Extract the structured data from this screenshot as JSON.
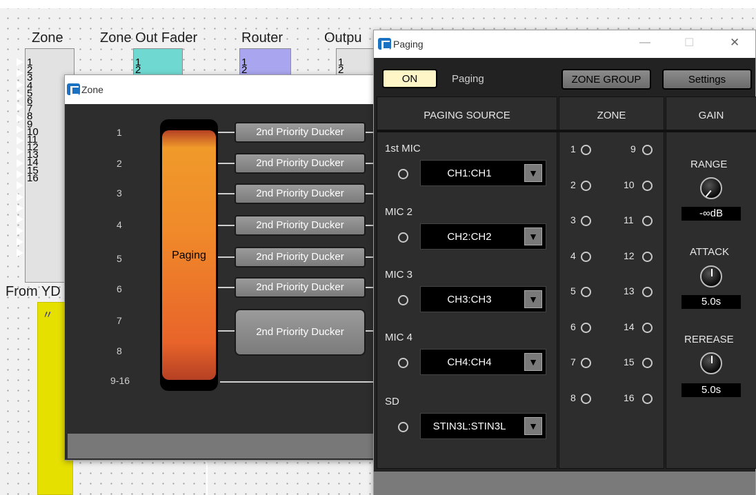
{
  "canvas": {
    "block_titles": {
      "zone": "Zone",
      "zone_out_fader": "Zone Out Fader",
      "router": "Router",
      "output": "Outpu",
      "from": "From YD"
    },
    "zone_numbers": [
      "1",
      "2",
      "3",
      "4",
      "5",
      "6",
      "7",
      "8",
      "9",
      "10",
      "11",
      "12",
      "13",
      "14",
      "15",
      "16"
    ],
    "fader_numbers": [
      "1",
      "2"
    ],
    "router_numbers": [
      "1",
      "2"
    ],
    "output_numbers": [
      "1",
      "2"
    ],
    "colors": {
      "fader": "#6fd8d0",
      "router": "#a9a6ef",
      "from_block": "#e6e000"
    }
  },
  "zone_window": {
    "title": "Zone",
    "channel_labels": [
      "1",
      "2",
      "3",
      "4",
      "5",
      "6",
      "7",
      "8",
      "9-16"
    ],
    "paging_label": "Paging",
    "ducker_labels": [
      "2nd Priority Ducker",
      "2nd Priority Ducker",
      "2nd Priority Ducker",
      "2nd Priority Ducker",
      "2nd Priority Ducker",
      "2nd Priority Ducker",
      "2nd Priority Ducker"
    ]
  },
  "paging_window": {
    "title": "Paging",
    "window_controls": {
      "minimize": "—",
      "maximize": "☐",
      "close": "✕"
    },
    "on_button": "ON",
    "paging_label": "Paging",
    "zone_group_button": "ZONE GROUP",
    "settings_button": "Settings",
    "headers": {
      "source": "PAGING SOURCE",
      "zone": "ZONE",
      "gain": "GAIN"
    },
    "sources": [
      {
        "label": "1st MIC",
        "value": "CH1:CH1"
      },
      {
        "label": "MIC 2",
        "value": "CH2:CH2"
      },
      {
        "label": "MIC 3",
        "value": "CH3:CH3"
      },
      {
        "label": "MIC 4",
        "value": "CH4:CH4"
      },
      {
        "label": "SD",
        "value": "STIN3L:STIN3L"
      }
    ],
    "dropdown_icon": "triangle-down-icon",
    "zones_left": [
      "1",
      "2",
      "3",
      "4",
      "5",
      "6",
      "7",
      "8"
    ],
    "zones_right": [
      "9",
      "10",
      "11",
      "12",
      "13",
      "14",
      "15",
      "16"
    ],
    "gain": {
      "range": {
        "label": "RANGE",
        "value": "-∞dB"
      },
      "attack": {
        "label": "ATTACK",
        "value": "5.0s"
      },
      "release": {
        "label": "REREASE",
        "value": "5.0s"
      }
    }
  }
}
